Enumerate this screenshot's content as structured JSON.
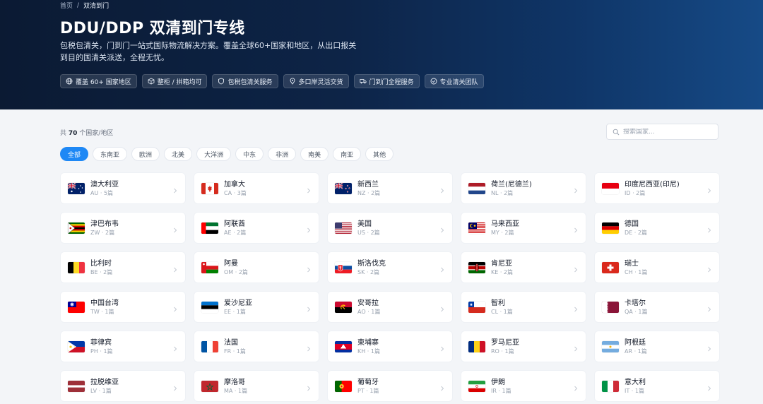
{
  "breadcrumb": {
    "home": "首页",
    "separator": "/",
    "current": "双清到门"
  },
  "hero": {
    "title": "DDU/DDP 双清到门专线",
    "description": "包税包清关，门到门一站式国际物流解决方案。覆盖全球60+国家和地区，从出口报关到目的国清关派送，全程无忧。",
    "tags": [
      {
        "icon": "globe-icon",
        "label": "覆盖 60+ 国家地区"
      },
      {
        "icon": "box-icon",
        "label": "整柜 / 拼箱均可"
      },
      {
        "icon": "shield-icon",
        "label": "包税包清关服务"
      },
      {
        "icon": "location-pin-icon",
        "label": "多口岸灵活交货"
      },
      {
        "icon": "truck-icon",
        "label": "门到门全程服务"
      },
      {
        "icon": "check-circle-icon",
        "label": "专业清关团队"
      }
    ]
  },
  "count": {
    "prefix": "共",
    "number": "70",
    "suffix": "个国家/地区"
  },
  "search": {
    "placeholder": "搜索国家..."
  },
  "filters": [
    "全部",
    "东南亚",
    "欧洲",
    "北美",
    "大洋洲",
    "中东",
    "非洲",
    "南美",
    "南亚",
    "其他"
  ],
  "accent_color": "#1e88f5",
  "countries": [
    {
      "name": "澳大利亚",
      "meta": "AU · 5篇",
      "flag": "AU"
    },
    {
      "name": "加拿大",
      "meta": "CA · 3篇",
      "flag": "CA"
    },
    {
      "name": "新西兰",
      "meta": "NZ · 2篇",
      "flag": "NZ"
    },
    {
      "name": "荷兰(尼德兰)",
      "meta": "NL · 2篇",
      "flag": "NL"
    },
    {
      "name": "印度尼西亚(印尼)",
      "meta": "ID · 2篇",
      "flag": "ID"
    },
    {
      "name": "津巴布韦",
      "meta": "ZW · 2篇",
      "flag": "ZW"
    },
    {
      "name": "阿联酋",
      "meta": "AE · 2篇",
      "flag": "AE"
    },
    {
      "name": "美国",
      "meta": "US · 2篇",
      "flag": "US"
    },
    {
      "name": "马来西亚",
      "meta": "MY · 2篇",
      "flag": "MY"
    },
    {
      "name": "德国",
      "meta": "DE · 2篇",
      "flag": "DE"
    },
    {
      "name": "比利时",
      "meta": "BE · 2篇",
      "flag": "BE"
    },
    {
      "name": "阿曼",
      "meta": "OM · 2篇",
      "flag": "OM"
    },
    {
      "name": "斯洛伐克",
      "meta": "SK · 2篇",
      "flag": "SK"
    },
    {
      "name": "肯尼亚",
      "meta": "KE · 2篇",
      "flag": "KE"
    },
    {
      "name": "瑞士",
      "meta": "CH · 1篇",
      "flag": "CH"
    },
    {
      "name": "中国台湾",
      "meta": "TW · 1篇",
      "flag": "TW"
    },
    {
      "name": "爱沙尼亚",
      "meta": "EE · 1篇",
      "flag": "EE"
    },
    {
      "name": "安哥拉",
      "meta": "AO · 1篇",
      "flag": "AO"
    },
    {
      "name": "智利",
      "meta": "CL · 1篇",
      "flag": "CL"
    },
    {
      "name": "卡塔尔",
      "meta": "QA · 1篇",
      "flag": "QA"
    },
    {
      "name": "菲律宾",
      "meta": "PH · 1篇",
      "flag": "PH"
    },
    {
      "name": "法国",
      "meta": "FR · 1篇",
      "flag": "FR"
    },
    {
      "name": "柬埔寨",
      "meta": "KH · 1篇",
      "flag": "KH"
    },
    {
      "name": "罗马尼亚",
      "meta": "RO · 1篇",
      "flag": "RO"
    },
    {
      "name": "阿根廷",
      "meta": "AR · 1篇",
      "flag": "AR"
    },
    {
      "name": "拉脱维亚",
      "meta": "LV · 1篇",
      "flag": "LV"
    },
    {
      "name": "摩洛哥",
      "meta": "MA · 1篇",
      "flag": "MA"
    },
    {
      "name": "葡萄牙",
      "meta": "PT · 1篇",
      "flag": "PT"
    },
    {
      "name": "伊朗",
      "meta": "IR · 1篇",
      "flag": "IR"
    },
    {
      "name": "意大利",
      "meta": "IT · 1篇",
      "flag": "IT"
    }
  ]
}
